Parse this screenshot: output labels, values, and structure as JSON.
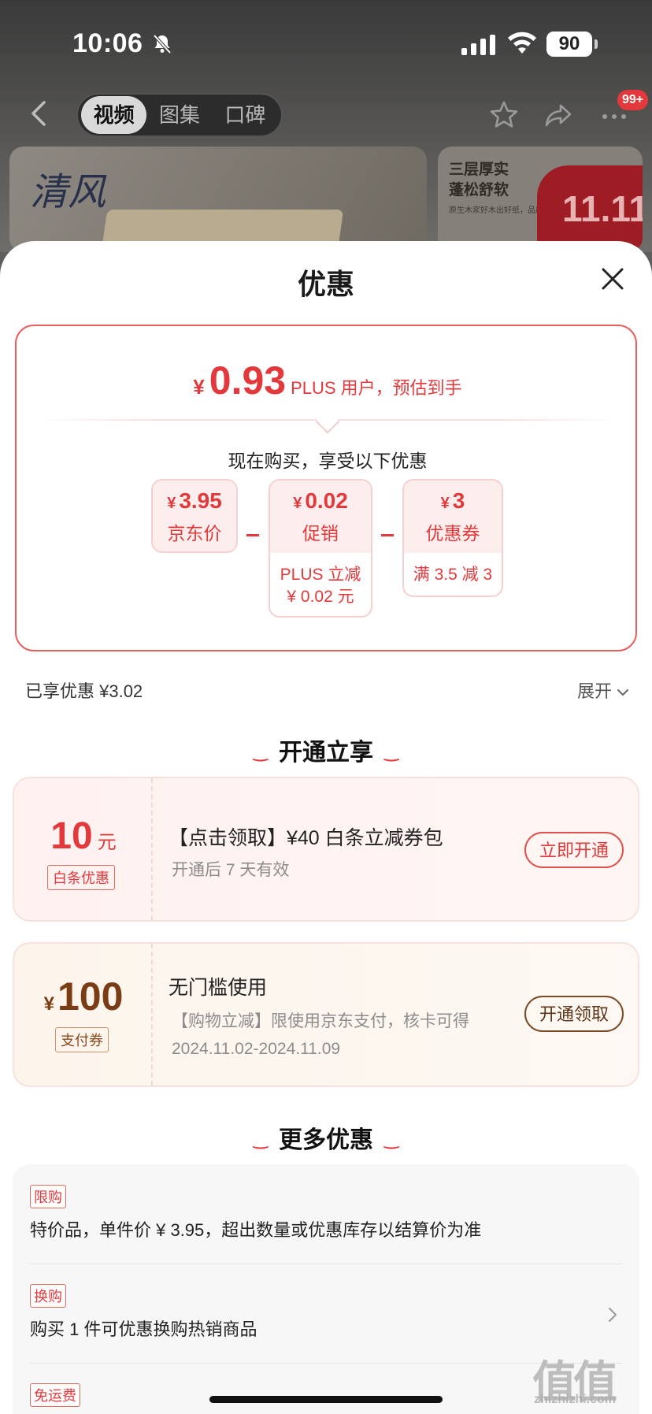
{
  "status_bar": {
    "time": "10:06",
    "battery": "90"
  },
  "nav": {
    "tabs": [
      "视频",
      "图集",
      "口碑"
    ],
    "active_tab_index": 0,
    "cart_badge": "99+"
  },
  "banner": {
    "brand": "清风",
    "right_title": "三层厚实\n蓬松舒软",
    "right_sub": "原生木浆好木出好纸，品质",
    "promo_badge": "11.11"
  },
  "sheet": {
    "title": "优惠",
    "price": {
      "currency": "¥",
      "value": "0.93",
      "note": "PLUS 用户，预估到手"
    },
    "now_buy_text": "现在购买，享受以下优惠",
    "breakdown": [
      {
        "value": "3.95",
        "label": "京东价",
        "detail": ""
      },
      {
        "value": "0.02",
        "label": "促销",
        "detail": "PLUS 立减\n¥ 0.02 元"
      },
      {
        "value": "3",
        "label": "优惠券",
        "detail": "满 3.5 减 3"
      }
    ],
    "enjoyed": "已享优惠 ¥3.02",
    "expand": "展开"
  },
  "open_section": {
    "title": "开通立享",
    "coupons": [
      {
        "amount": "10",
        "unit": "元",
        "tag": "白条优惠",
        "title": "【点击领取】¥40 白条立减券包",
        "desc": "开通后 7 天有效",
        "button": "立即开通"
      },
      {
        "currency": "¥",
        "amount": "100",
        "tag": "支付券",
        "title": "无门槛使用",
        "desc": "【购物立减】限使用京东支付，核卡可得",
        "date": "2024.11.02-2024.11.09",
        "button": "开通领取"
      }
    ]
  },
  "more_section": {
    "title": "更多优惠",
    "items": [
      {
        "tag": "限购",
        "text": "特价品，单件价 ¥ 3.95，超出数量或优惠库存以结算价为准"
      },
      {
        "tag": "换购",
        "text": "购买 1 件可优惠换购热销商品"
      },
      {
        "tag": "免运费",
        "text": ""
      }
    ]
  },
  "watermark": {
    "main": "值值值",
    "sub": "zhizhizhi.com"
  },
  "colors": {
    "accent": "#e4393c",
    "accent_bg": "#fdeeee",
    "gold_btn": "#8a5a2b"
  }
}
